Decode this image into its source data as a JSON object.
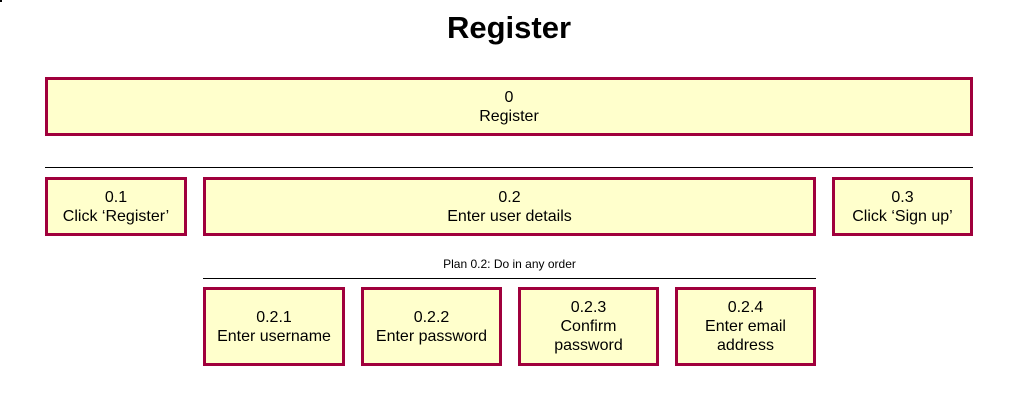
{
  "diagram": {
    "title": "Register",
    "root": {
      "id": "0",
      "label": "Register"
    },
    "level1": [
      {
        "id": "0.1",
        "label": "Click ‘Register’"
      },
      {
        "id": "0.2",
        "label": "Enter user details"
      },
      {
        "id": "0.3",
        "label": "Click ‘Sign up’"
      }
    ],
    "plan_0_2": "Plan 0.2: Do in any order",
    "level2": [
      {
        "id": "0.2.1",
        "label": "Enter username"
      },
      {
        "id": "0.2.2",
        "label": "Enter password"
      },
      {
        "id": "0.2.3",
        "label": "Confirm password"
      },
      {
        "id": "0.2.4",
        "label": "Enter email address"
      }
    ],
    "colors": {
      "box_fill": "#ffffcc",
      "box_border": "#a0003c"
    }
  }
}
